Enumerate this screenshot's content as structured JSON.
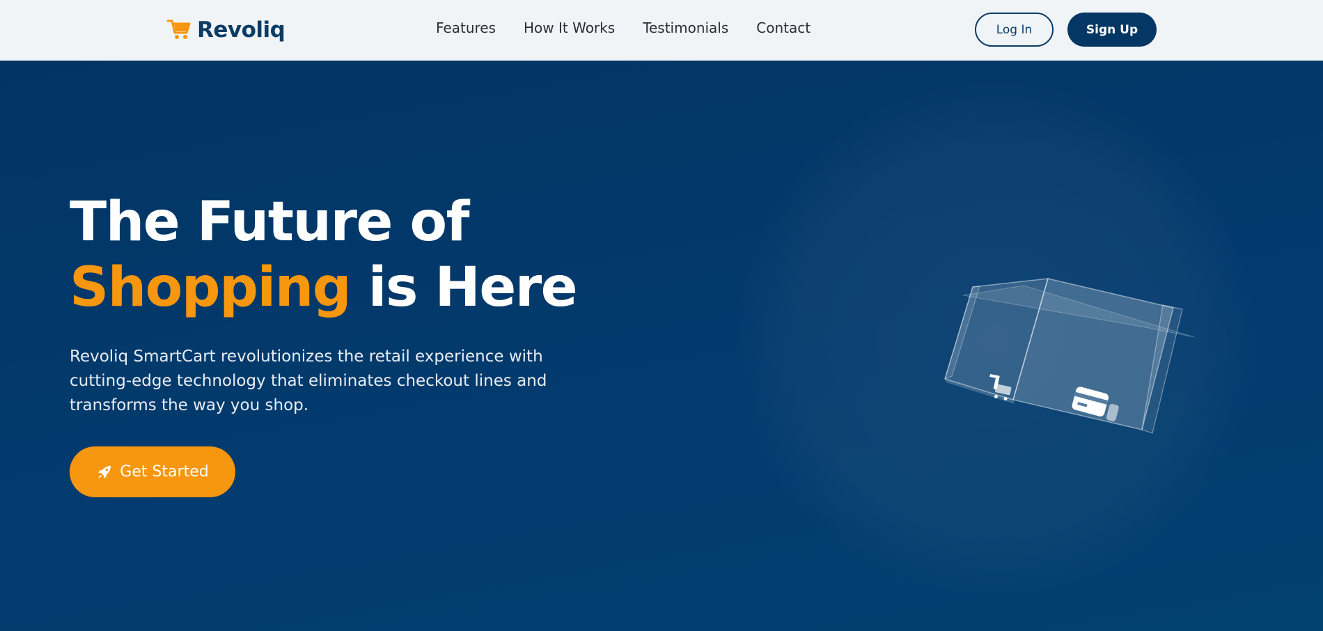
{
  "header": {
    "brand": "Revoliq",
    "logo_icon": "shopping-cart-icon",
    "nav": [
      {
        "label": "Features"
      },
      {
        "label": "How It Works"
      },
      {
        "label": "Testimonials"
      },
      {
        "label": "Contact"
      }
    ],
    "login_label": "Log In",
    "signup_label": "Sign Up"
  },
  "hero": {
    "title_line1": "The Future of",
    "title_accent": "Shopping",
    "title_rest": " is Here",
    "description": "Revoliq SmartCart revolutionizes the retail experience with cutting-edge technology that eliminates checkout lines and transforms the way you shop.",
    "cta_label": "Get Started",
    "cta_icon": "rocket-icon",
    "illustration_icons": [
      "shopping-cart-icon",
      "credit-card-icon"
    ]
  },
  "colors": {
    "navy": "#023766",
    "accent": "#f7960f",
    "nav_bg": "#f1f4f7"
  }
}
